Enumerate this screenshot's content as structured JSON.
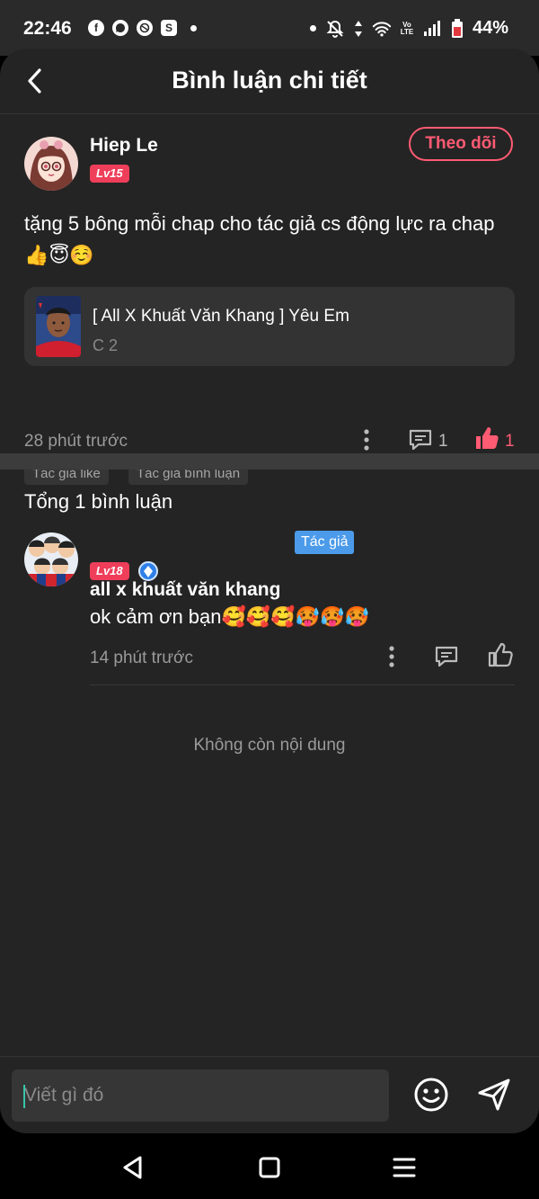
{
  "status_bar": {
    "time": "22:46",
    "notification_icons": [
      "facebook-icon",
      "messenger-icon",
      "browser-icon",
      "shop-icon"
    ],
    "battery": "44%",
    "volte": "Vo LTE"
  },
  "header": {
    "title": "Bình luận chi tiết"
  },
  "post": {
    "username": "Hiep Le",
    "level": "Lv15",
    "follow_label": "Theo dõi",
    "text": "tặng 5 bông mỗi chap cho tác giả cs động lực ra chap👍😇☺️",
    "story": {
      "title": "[ All X Khuất Văn Khang ] Yêu Em",
      "chapter": "C 2"
    },
    "time": "28 phút trước",
    "comment_count": "1",
    "like_count": "1",
    "tags": [
      "Tác giả like",
      "Tác giả bình luận"
    ]
  },
  "replies": {
    "total_label": "Tổng 1 bình luận",
    "items": [
      {
        "username": "all x khuất văn khang",
        "author_badge": "Tác giả",
        "level": "Lv18",
        "text": "ok cảm ơn bạn🥰🥰🥰🥵🥵🥵",
        "time": "14 phút trước"
      }
    ],
    "end_text": "Không còn nội dung"
  },
  "composer": {
    "placeholder": "Viết gì đó"
  },
  "colors": {
    "accent": "#ff5b73",
    "level_badge": "#ee3e5a",
    "author_badge": "#4c9bea",
    "background": "#242424"
  }
}
